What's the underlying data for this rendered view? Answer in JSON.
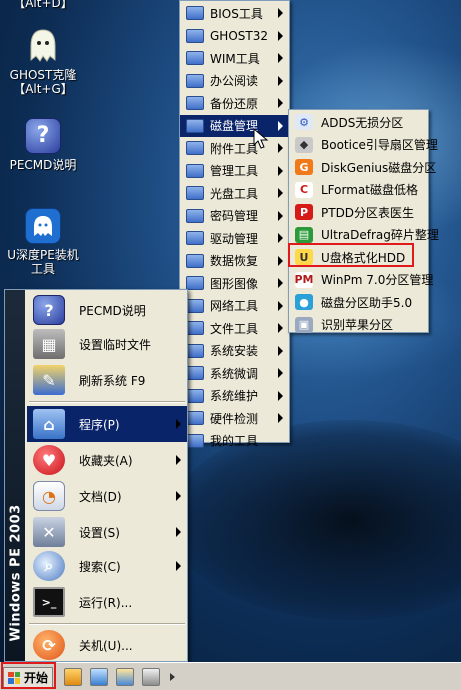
{
  "desktop": {
    "icons": [
      {
        "label_1": "【Alt+D】",
        "label_2": ""
      },
      {
        "label_1": "GHOST克隆",
        "label_2": "【Alt+G】"
      },
      {
        "label_1": "PECMD说明",
        "label_2": ""
      },
      {
        "label_1": "U深度PE装机",
        "label_2": "工具"
      }
    ]
  },
  "programs_menu": {
    "items": [
      "BIOS工具",
      "GHOST32",
      "WIM工具",
      "办公阅读",
      "备份还原",
      "磁盘管理",
      "附件工具",
      "管理工具",
      "光盘工具",
      "密码管理",
      "驱动管理",
      "数据恢复",
      "图形图像",
      "网络工具",
      "文件工具",
      "系统安装",
      "系统微调",
      "系统维护",
      "硬件检测",
      "我的工具"
    ],
    "highlighted": "磁盘管理"
  },
  "disk_menu": {
    "items": [
      "ADDS无损分区",
      "Bootice引导扇区管理",
      "DiskGenius磁盘分区",
      "LFormat磁盘低格",
      "PTDD分区表医生",
      "UltraDefrag碎片整理",
      "U盘格式化HDD",
      "WinPm 7.0分区管理",
      "磁盘分区助手5.0",
      "识别苹果分区"
    ],
    "boxed": "U盘格式化HDD"
  },
  "start_menu": {
    "sidebar_text": "Windows PE 2003",
    "items": [
      "PECMD说明",
      "设置临时文件",
      "刷新系统 F9",
      "程序(P)",
      "收藏夹(A)",
      "文档(D)",
      "设置(S)",
      "搜索(C)",
      "运行(R)...",
      "关机(U)..."
    ]
  },
  "taskbar": {
    "start_label": "开始"
  },
  "colors": {
    "highlight": "#0a246a",
    "annotation_box": "#e01a1a",
    "menu_bg": "#ece9d8"
  }
}
